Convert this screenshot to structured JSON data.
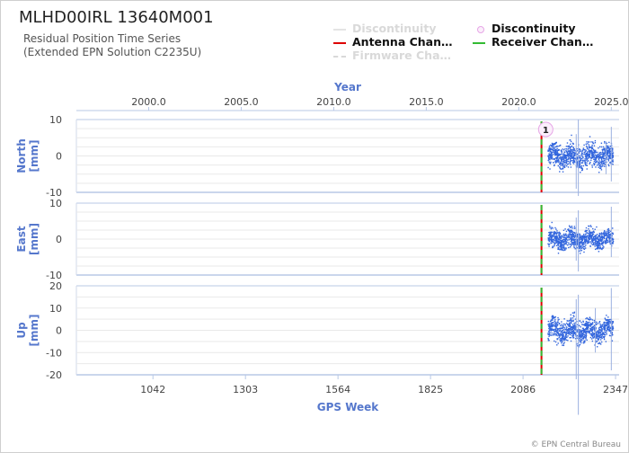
{
  "title": "MLHD00IRL 13640M001",
  "subtitle": [
    "Residual Position Time Series",
    "(Extended EPN Solution C2235U)"
  ],
  "legend": {
    "discontinuity_off": "Discontinuity",
    "discontinuity_on": "Discontinuity",
    "antenna": "Antenna Chan…",
    "receiver": "Receiver Chan…",
    "firmware": "Firmware Cha…",
    "antenna_color": "#dd0000",
    "receiver_color": "#33bb33",
    "disabled_color": "#d9d9d9"
  },
  "credit": "© EPN Central Bureau",
  "colors": {
    "axis_label": "#5577cc",
    "data": "#3366dd",
    "grid": "#e9e9e9",
    "axis": "#b8c8e6"
  },
  "chart_data": {
    "type": "scatter",
    "x_label": "GPS Week",
    "x_ticks": [
      1042,
      1303,
      1564,
      1825,
      2086,
      2347
    ],
    "x_range": [
      826,
      2357
    ],
    "top_axis": {
      "label": "Year",
      "ticks": [
        "2000.0",
        "2005.0",
        "2010.0",
        "2015.0",
        "2020.0",
        "2025.0"
      ]
    },
    "events": {
      "antenna_change_week": 2138,
      "receiver_change_week": 2138
    },
    "discontinuities": [
      {
        "label": "1",
        "week": 2155
      }
    ],
    "data_span_weeks": [
      2155,
      2339
    ],
    "panels": [
      {
        "name": "North",
        "unit": "[mm]",
        "ticks": [
          10,
          0,
          -10
        ],
        "ylim": [
          -10,
          10
        ],
        "spread_mm": 3,
        "outliers": [
          {
            "week": 2242,
            "lo": -11,
            "hi": 10
          },
          {
            "week": 2236,
            "lo": -9,
            "hi": 6
          },
          {
            "week": 2335,
            "lo": -7,
            "hi": 8
          },
          {
            "week": 2320,
            "lo": -5,
            "hi": 4
          }
        ]
      },
      {
        "name": "East",
        "unit": "[mm]",
        "ticks": [
          10,
          0,
          -10
        ],
        "ylim": [
          -10,
          10
        ],
        "spread_mm": 2.5,
        "outliers": [
          {
            "week": 2242,
            "lo": -9,
            "hi": 8
          },
          {
            "week": 2236,
            "lo": -6,
            "hi": 6
          },
          {
            "week": 2335,
            "lo": -5,
            "hi": 9
          }
        ]
      },
      {
        "name": "Up",
        "unit": "[mm]",
        "ticks": [
          20,
          10,
          0,
          -10,
          -20
        ],
        "ylim": [
          -20,
          20
        ],
        "spread_mm": 5,
        "outliers": [
          {
            "week": 2242,
            "lo": -38,
            "hi": 16
          },
          {
            "week": 2236,
            "lo": -22,
            "hi": 14
          },
          {
            "week": 2335,
            "lo": -18,
            "hi": 19
          },
          {
            "week": 2290,
            "lo": -10,
            "hi": 10
          }
        ]
      }
    ]
  }
}
